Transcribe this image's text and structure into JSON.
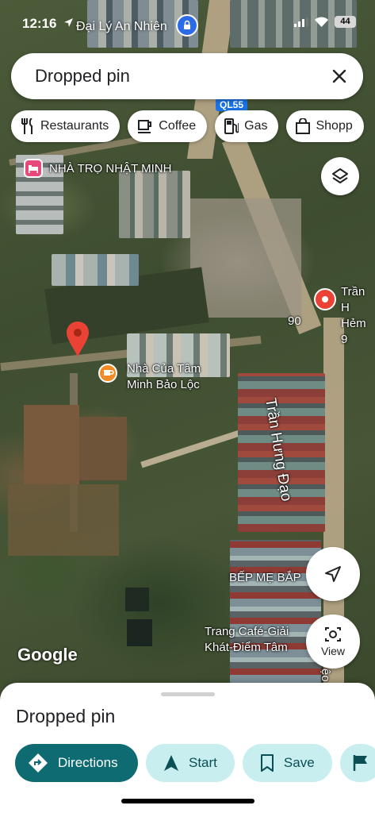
{
  "status_bar": {
    "time": "12:16",
    "location_text": "Đại Lý An Nhiên",
    "battery": "44"
  },
  "search": {
    "value": "Dropped pin"
  },
  "chips": [
    {
      "label": "Restaurants",
      "icon": "fork-knife-icon"
    },
    {
      "label": "Coffee",
      "icon": "coffee-cup-icon"
    },
    {
      "label": "Gas",
      "icon": "gas-pump-icon"
    },
    {
      "label": "Shopp",
      "icon": "shopping-bag-icon"
    }
  ],
  "map": {
    "road_shield": "QL55",
    "labels": {
      "hotel": "NHÀ TRỌ NHẬT MINH",
      "cafe_line1": "Nhà Của Tâm",
      "cafe_line2": "Minh Bảo Lộc",
      "street": "Trần Hưng Đạo",
      "alley_number": "90",
      "place_right_line1": "Trần H",
      "place_right_line2": "Hẻm 9",
      "restaurant": "BẾP MẸ BẮP",
      "cafe2_line1": "Trang Café-Giải",
      "cafe2_line2": "Khát-Điểm Tâm",
      "edge_text": "ệo"
    },
    "logo": "Google",
    "view_label": "View",
    "colors": {
      "hotel_pin": "#e8497b",
      "cafe_pin": "#f28b25",
      "red_pin": "#ea4335",
      "road_shield": "#1a73e8"
    }
  },
  "sheet": {
    "title": "Dropped pin",
    "actions": [
      {
        "label": "Directions",
        "icon": "directions-icon"
      },
      {
        "label": "Start",
        "icon": "navigation-arrow-icon"
      },
      {
        "label": "Save",
        "icon": "bookmark-icon"
      },
      {
        "label": "",
        "icon": "flag-icon"
      }
    ],
    "colors": {
      "primary": "#0e6b72",
      "secondary": "#c8eef0"
    }
  }
}
